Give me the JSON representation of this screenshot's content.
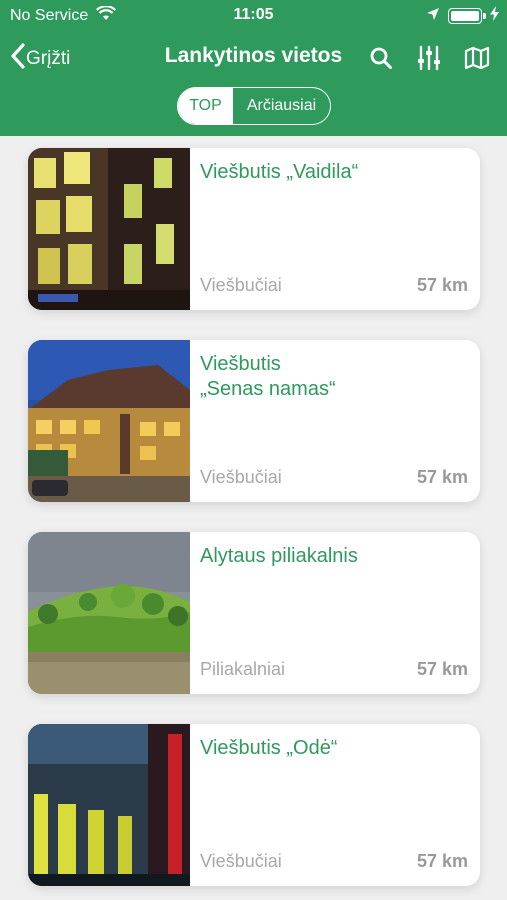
{
  "status_bar": {
    "carrier": "No Service",
    "time": "11:05"
  },
  "nav": {
    "back_label": "Grįžti",
    "title": "Lankytinos vietos",
    "icons": [
      "search-icon",
      "filter-sliders-icon",
      "map-icon"
    ]
  },
  "segments": {
    "top": "TOP",
    "nearest": "Arčiausiai",
    "selected": "top"
  },
  "colors": {
    "accent": "#2e9a5c",
    "muted_text": "#a8a8a8"
  },
  "places": [
    {
      "title": "Viešbutis „Vaidila“",
      "category": "Viešbučiai",
      "distance": "57 km"
    },
    {
      "title": "Viešbutis\n„Senas namas“",
      "category": "Viešbučiai",
      "distance": "57 km"
    },
    {
      "title": "Alytaus piliakalnis",
      "category": "Piliakalniai",
      "distance": "57 km"
    },
    {
      "title": "Viešbutis „Odė“",
      "category": "Viešbučiai",
      "distance": "57 km"
    }
  ]
}
